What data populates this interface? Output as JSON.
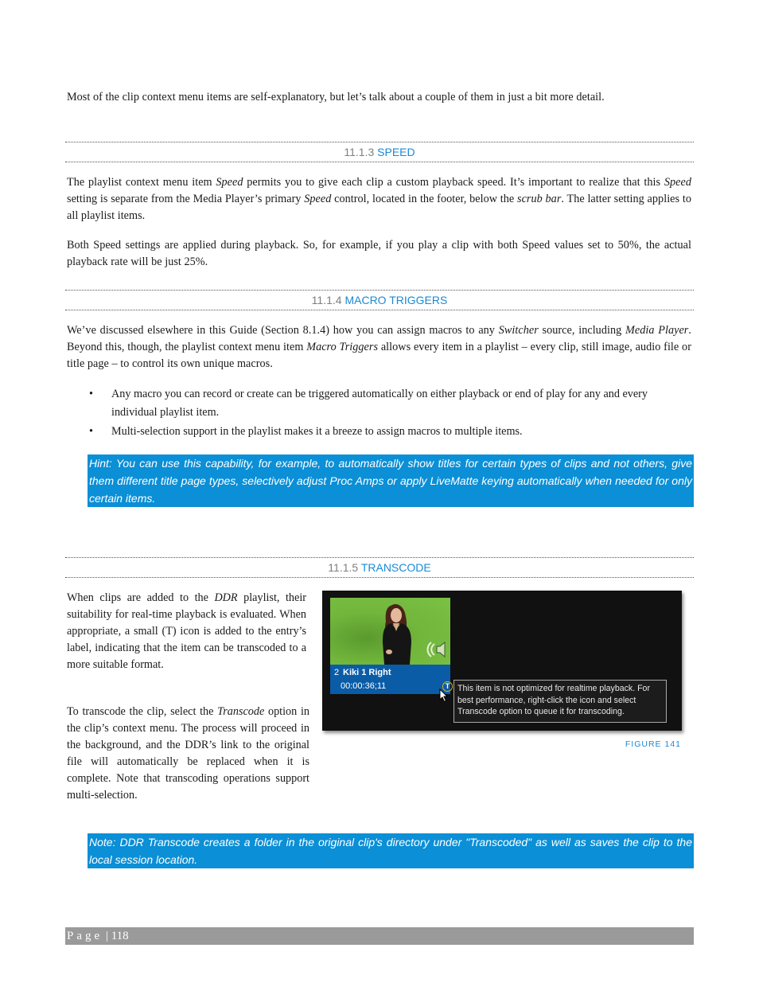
{
  "intro": "Most of the clip context menu items are self-explanatory, but let’s talk about a couple of them in just a bit more detail.",
  "sections": {
    "speed": {
      "number": "11.1.3",
      "title": "SPEED",
      "p1": [
        {
          "t": "The playlist context menu item "
        },
        {
          "t": "Speed",
          "i": true
        },
        {
          "t": " permits you to give each clip a custom playback speed.  It’s important to realize that this "
        },
        {
          "t": "Speed",
          "i": true
        },
        {
          "t": " setting is separate from the Media Player’s primary "
        },
        {
          "t": "Speed",
          "i": true
        },
        {
          "t": " control, located in the footer, below the "
        },
        {
          "t": "scrub bar",
          "i": true
        },
        {
          "t": ".  The latter setting applies to all playlist items."
        }
      ],
      "p2": "Both Speed settings are applied during playback.  So, for example, if you play a clip with both Speed values set to 50%, the actual playback rate will be just 25%."
    },
    "macro": {
      "number": "11.1.4",
      "title": "MACRO TRIGGERS",
      "p1": [
        {
          "t": "We’ve discussed elsewhere in this Guide (Section 8.1.4) how you can assign macros to any "
        },
        {
          "t": "Switcher",
          "i": true
        },
        {
          "t": " source, including "
        },
        {
          "t": "Media Player",
          "i": true
        },
        {
          "t": ".  Beyond this, though, the playlist context menu item "
        },
        {
          "t": "Macro Triggers",
          "i": true
        },
        {
          "t": " allows every item in a playlist – every clip, still image, audio file or title page – to control its own unique macros."
        }
      ],
      "bullets": [
        "Any macro you can record or create can be triggered automatically on either playback or end of play for any and every individual playlist item.",
        "Multi-selection support in the playlist makes it a breeze to assign macros to multiple items."
      ],
      "bullet_glyph": "•",
      "hint": "Hint: You can use this capability, for example, to automatically show titles for certain types of clips and not others, give them different title page types, selectively adjust Proc Amps or apply LiveMatte keying automatically when needed for only certain items."
    },
    "transcode": {
      "number": "11.1.5",
      "title": "TRANSCODE",
      "p1": [
        {
          "t": "When clips are added to the "
        },
        {
          "t": "DDR",
          "i": true
        },
        {
          "t": " playlist, their suitability for real-time playback is evaluated. When appropriate, a small (T) icon is added to the entry’s label, indicating that the item can be transcoded to a more suitable format."
        }
      ],
      "p2": [
        {
          "t": "To transcode the clip, select the "
        },
        {
          "t": "Transcode",
          "i": true
        },
        {
          "t": " option in the clip’s context menu. The process will proceed in the background, and the DDR’s link to the original file will automatically be replaced when it is complete.  Note that transcoding operations support multi-selection."
        }
      ],
      "note": "Note:  DDR Transcode creates a folder in the original clip's directory under \"Transcoded\" as well as saves the clip to the local session location."
    }
  },
  "figure": {
    "clip_index": "2",
    "clip_name": "Kiki 1 Right",
    "clip_duration": "00:00:36;11",
    "transcode_icon_letter": "T",
    "tooltip": "This item is not optimized for realtime playback. For best performance, right-click the icon and select Transcode option to queue it for transcoding.",
    "caption": "FIGURE 141"
  },
  "footer": {
    "page_label": "Page",
    "separator": "|",
    "page_number": "118"
  },
  "colors": {
    "accent": "#1a8ad4",
    "callout_bg": "#0b8fd6",
    "clip_label_bg": "#0a5ca6",
    "footer_bg": "#9a9a9a"
  }
}
